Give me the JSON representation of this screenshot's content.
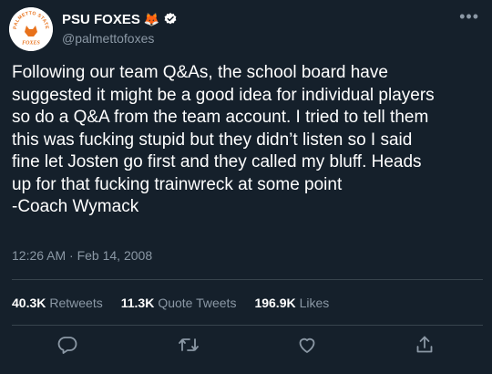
{
  "account": {
    "display_name": "PSU FOXES",
    "emoji": "🦊",
    "handle": "@palmettofoxes",
    "avatar_text_top": "PALMETTO STATE",
    "avatar_text_bottom": "FOXES"
  },
  "tweet": {
    "lines": [
      "Following our team Q&As, the school board have",
      "suggested it might be a good idea for individual players",
      "so do a Q&A from the team account. I tried to tell them",
      "this was fucking stupid but they didn’t listen so I said",
      "fine let Josten go first and they called my bluff. Heads",
      "up for that fucking trainwreck at some point",
      "-Coach Wymack"
    ],
    "timestamp": "12:26 AM · Feb 14, 2008"
  },
  "stats": {
    "retweets_count": "40.3K",
    "retweets_label": "Retweets",
    "quotes_count": "11.3K",
    "quotes_label": "Quote Tweets",
    "likes_count": "196.9K",
    "likes_label": "Likes"
  },
  "icons": {
    "reply": "reply-icon",
    "retweet": "retweet-icon",
    "like": "like-icon",
    "share": "share-icon",
    "verified": "verified-icon",
    "more": "more-icon"
  },
  "colors": {
    "background": "#15202b",
    "text": "#ffffff",
    "secondary": "#8b98a5",
    "divider": "#38444d",
    "brand_orange": "#e8721c"
  }
}
